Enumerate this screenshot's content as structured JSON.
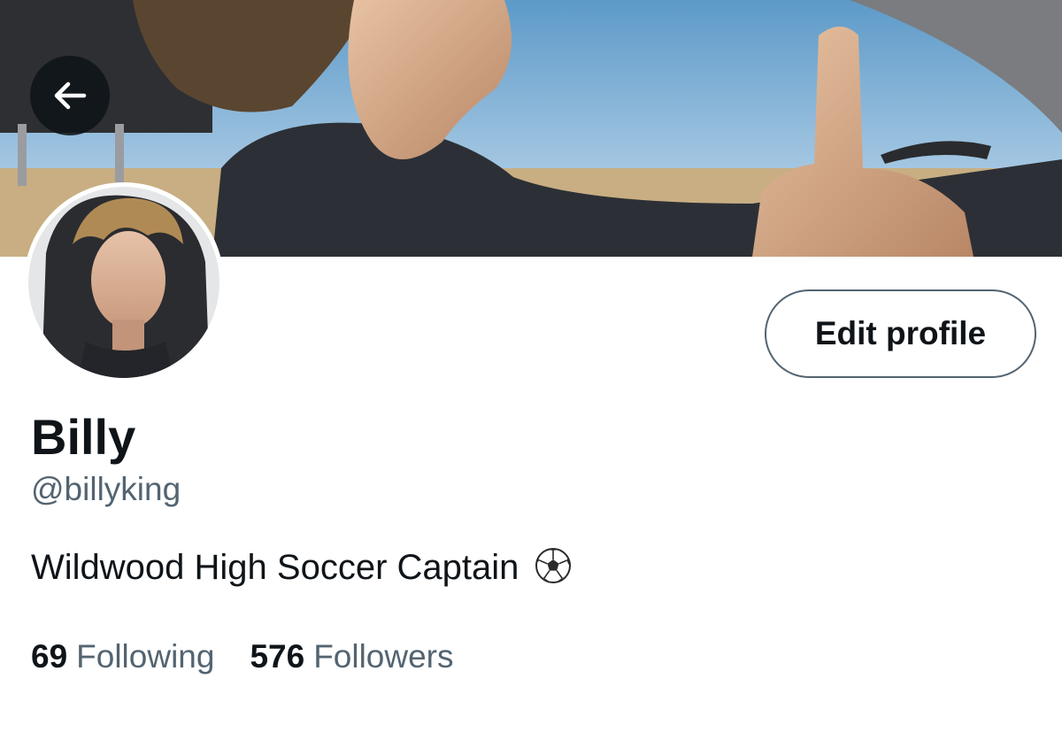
{
  "header": {
    "back_icon": "arrow-left-icon"
  },
  "profile": {
    "display_name": "Billy",
    "handle": "@billyking",
    "bio": "Wildwood High Soccer Captain",
    "bio_emoji": "soccer-ball-icon",
    "edit_button_label": "Edit profile"
  },
  "stats": {
    "following_count": "69",
    "following_label": "Following",
    "followers_count": "576",
    "followers_label": "Followers"
  },
  "colors": {
    "primary_text": "#0f1419",
    "secondary_text": "#536471",
    "button_border": "#536471",
    "background": "#ffffff",
    "back_button_bg": "#0f1419"
  }
}
